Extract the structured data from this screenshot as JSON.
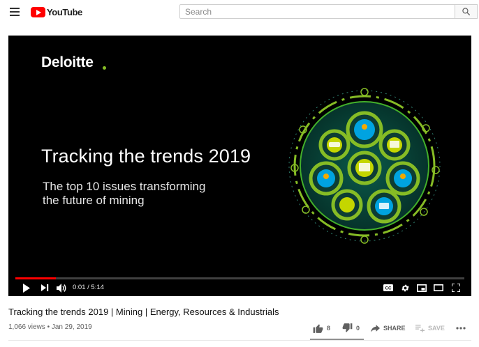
{
  "header": {
    "logo_text": "YouTube",
    "search_placeholder": "Search",
    "search_icon": "magnifier-icon",
    "menu_icon": "hamburger-icon"
  },
  "player": {
    "slide": {
      "brand": "Deloitte",
      "title": "Tracking the trends 2019",
      "subtitle_line1": "The top 10 issues transforming",
      "subtitle_line2": "the future of mining"
    },
    "progress_fraction": 0.09,
    "time_display": "0:01 / 5:14",
    "controls": [
      "play-icon",
      "next-icon",
      "volume-icon",
      "captions-icon",
      "settings-icon",
      "miniplayer-icon",
      "theater-icon",
      "fullscreen-icon"
    ],
    "captions_label": "CC",
    "colors": {
      "progress": "#ff0000",
      "brand_green": "#86bc25"
    }
  },
  "video": {
    "title": "Tracking the trends 2019 | Mining | Energy, Resources & Industrials",
    "meta": "1,066 views • Jan 29, 2019"
  },
  "actions": {
    "likes": "8",
    "dislikes": "0",
    "share_label": "SHARE",
    "save_label": "SAVE",
    "more_icon": "more-horizontal-icon",
    "like_fraction": 1.0
  }
}
